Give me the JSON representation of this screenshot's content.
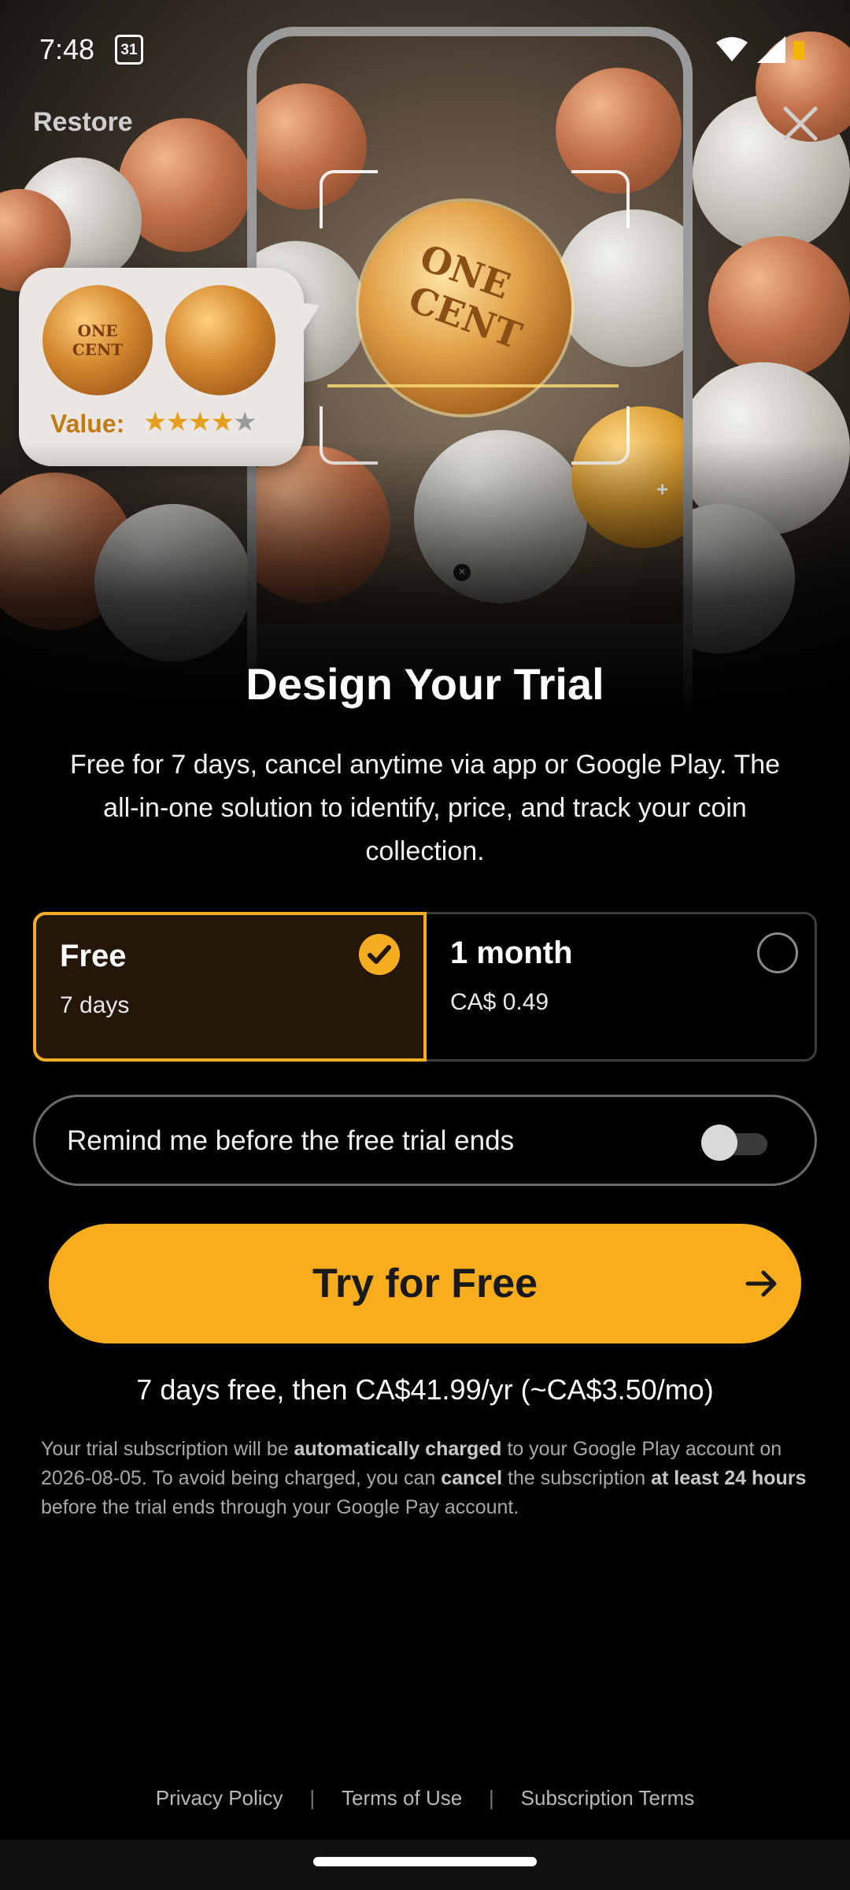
{
  "status_bar": {
    "time": "7:48",
    "calendar_day": "31",
    "icons": [
      "calendar-icon",
      "wifi-icon",
      "signal-icon",
      "battery-icon"
    ]
  },
  "header": {
    "restore_label": "Restore",
    "close_icon": "close-icon"
  },
  "hero": {
    "scanner_coin_text": [
      "ONE",
      "CENT"
    ],
    "value_card": {
      "coin_text": [
        "ONE",
        "CENT"
      ],
      "value_label": "Value:",
      "rating": 4,
      "rating_max": 5
    }
  },
  "content": {
    "title": "Design Your Trial",
    "subtitle": "Free for 7 days, cancel anytime via app or Google Play. The all-in-one solution to identify, price, and track your coin collection."
  },
  "plans": [
    {
      "name": "Free",
      "detail": "7 days",
      "selected": true
    },
    {
      "name": "1 month",
      "detail": "CA$ 0.49",
      "selected": false
    }
  ],
  "reminder": {
    "label": "Remind me before the free trial ends",
    "enabled": false
  },
  "cta": {
    "label": "Try for Free",
    "icon": "arrow-right-icon"
  },
  "pricing": {
    "summary": "7 days free, then CA$41.99/yr (~CA$3.50/mo)"
  },
  "fine_print": {
    "part1": "Your trial subscription will be ",
    "bold1": "automatically charged",
    "part2": " to your Google Play account on 2026-08-05. To avoid being charged, you can ",
    "bold2": "cancel",
    "part3": " the subscription ",
    "bold3": "at least 24 hours",
    "part4": " before the trial ends through your Google Pay account."
  },
  "footer": {
    "links": [
      "Privacy Policy",
      "Terms of Use",
      "Subscription Terms"
    ],
    "separator": "|"
  },
  "colors": {
    "accent": "#f8ad1c",
    "selected_plan_bg": "#241709",
    "background": "#000000"
  }
}
